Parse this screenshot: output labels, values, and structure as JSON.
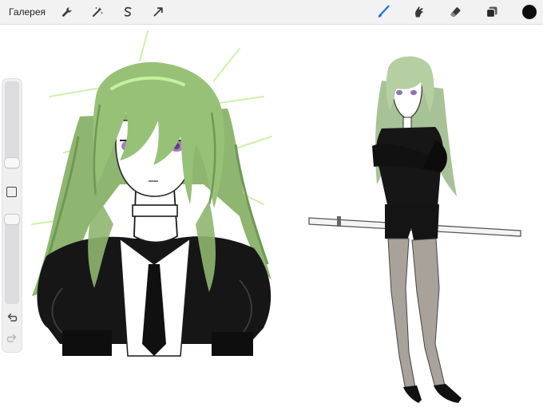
{
  "app": {
    "gallery_label": "Галерея"
  },
  "toolbar": {
    "left_icons": [
      "wrench-icon",
      "magic-wand-icon",
      "selection-s-icon",
      "transform-arrow-icon"
    ],
    "right_icons": [
      "brush-icon",
      "smudge-icon",
      "eraser-icon",
      "layers-icon",
      "color-swatch"
    ],
    "active_tool": "brush",
    "brush_color": "#1a6ee8",
    "current_color": "#0d0d0d"
  },
  "sidebar": {
    "size_slider_level": 0.9,
    "opacity_slider_level": 0.05,
    "buttons": [
      "modify-square",
      "undo-arrow-icon",
      "redo-arrow-icon"
    ]
  },
  "colors": {
    "hair_green": "#8fb670",
    "hair_light": "#b8e48a",
    "outfit_black": "#141414",
    "eye_purple": "#a37cc6",
    "leg_gray": "#a8a29b"
  }
}
